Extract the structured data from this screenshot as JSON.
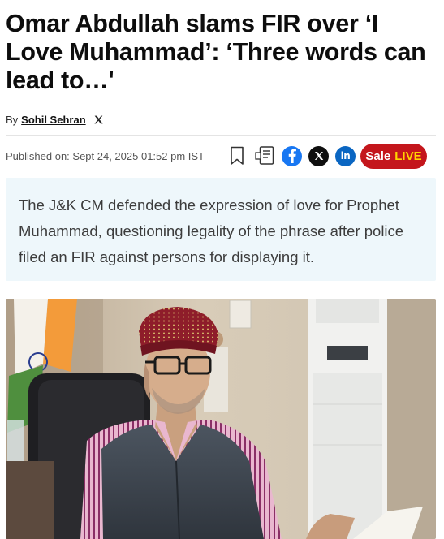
{
  "article": {
    "headline": "Omar Abdullah slams FIR over ‘I Love Muhammad’: ‘Three words can lead to…'",
    "byline_prefix": "By",
    "author": "Sohil Sehran",
    "published": "Published on: Sept 24, 2025 01:52 pm IST",
    "summary": "The J&K CM defended the expression of love for Prophet Muhammad, questioning legality of the phrase after police filed an FIR against persons for displaying it."
  },
  "toolbar": {
    "sale_label": "Sale",
    "live_label": "LIVE"
  },
  "icons": {
    "bookmark": "bookmark-icon",
    "reader": "reader-mode-icon",
    "facebook": "facebook-icon",
    "x": "x-icon",
    "linkedin": "linkedin-icon"
  },
  "colors": {
    "sale_bg": "#c4161c",
    "live_text": "#ffd400",
    "facebook": "#1877f2",
    "linkedin": "#0a66c2",
    "summary_bg": "#eef7fb"
  }
}
